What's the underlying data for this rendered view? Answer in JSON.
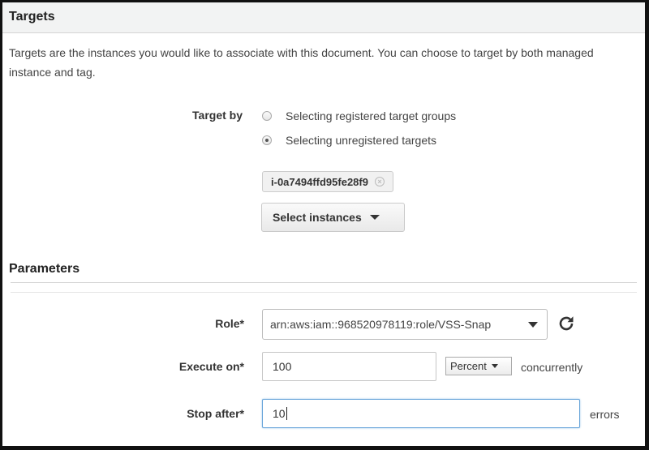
{
  "targets": {
    "title": "Targets",
    "description": "Targets are the instances you would like to associate with this document. You can choose to target by both managed instance and tag.",
    "target_by_label": "Target by",
    "options": [
      {
        "label": "Selecting registered target groups",
        "checked": false
      },
      {
        "label": "Selecting unregistered targets",
        "checked": true
      }
    ],
    "selected_instance": "i-0a7494ffd95fe28f9",
    "select_instances_label": "Select instances"
  },
  "parameters": {
    "title": "Parameters",
    "role_label": "Role*",
    "role_value": "arn:aws:iam::968520978119:role/VSS-Snap",
    "execute_on_label": "Execute on*",
    "execute_on_value": "100",
    "execute_on_unit": "Percent",
    "execute_on_suffix": "concurrently",
    "stop_after_label": "Stop after*",
    "stop_after_value": "10",
    "stop_after_suffix": "errors"
  },
  "icons": {
    "refresh": "refresh-icon",
    "remove_chip": "close-icon",
    "dropdown": "chevron-down-icon"
  }
}
